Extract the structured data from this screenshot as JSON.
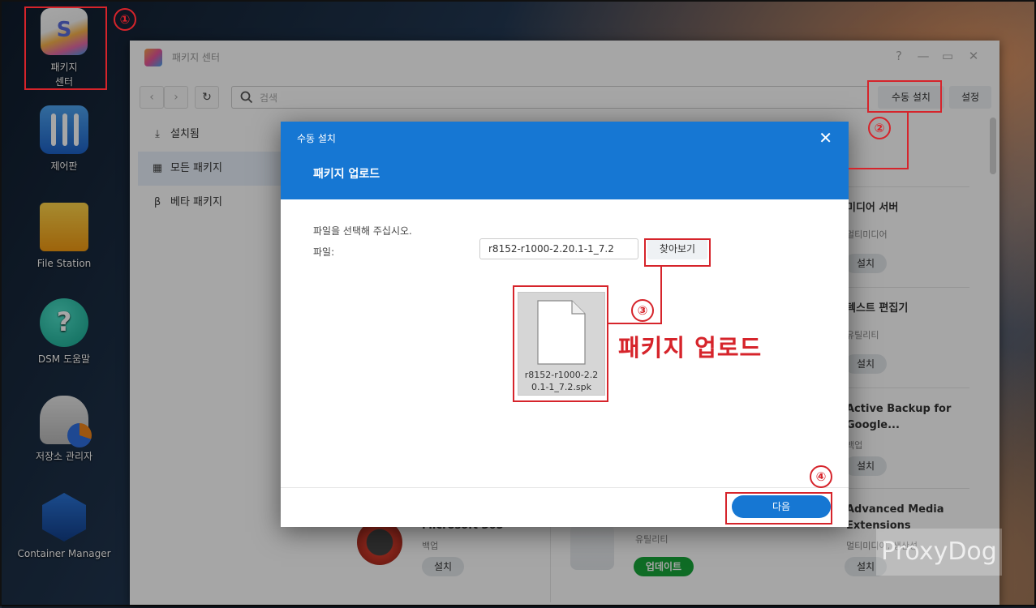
{
  "desktop": {
    "icons": [
      {
        "label_1": "패키지",
        "label_2": "센터"
      },
      {
        "label": "제어판"
      },
      {
        "label": "File Station"
      },
      {
        "label": "DSM 도움말"
      },
      {
        "label": "저장소 관리자"
      },
      {
        "label": "Container Manager"
      }
    ]
  },
  "window": {
    "title": "패키지 센터",
    "controls": {
      "help": "?",
      "minimize": "—",
      "maximize": "▭",
      "close": "✕"
    },
    "search_placeholder": "검색",
    "manual_install_label": "수동 설치",
    "settings_label": "설정",
    "sidebar": [
      {
        "label": "설치됨",
        "icon": "download-icon"
      },
      {
        "label": "모든 패키지",
        "icon": "grid-icon"
      },
      {
        "label": "베타 패키지",
        "icon": "beta-icon"
      }
    ],
    "cards_right": [
      {
        "name": "미디어 서버",
        "category": "멀티미디어",
        "action": "설치"
      },
      {
        "name": "텍스트 편집기",
        "category": "유틸리티",
        "action": "설치"
      },
      {
        "name": "Active Backup for Google...",
        "category": "백업",
        "action": "설치"
      },
      {
        "name": "Advanced Media Extensions",
        "category": "멀티미디어, 생산성",
        "action": "설치"
      }
    ],
    "cards_bottom": [
      {
        "name": "Microsoft 365",
        "category": "백업",
        "action": "설치"
      },
      {
        "category": "유틸리티",
        "action": "업데이트"
      }
    ]
  },
  "dialog": {
    "title": "수동 설치",
    "header": "패키지 업로드",
    "close": "✕",
    "instruction": "파일을 선택해 주십시오.",
    "file_label": "파일:",
    "file_value": "r8152-r1000-2.20.1-1_7.2",
    "browse_label": "찾아보기",
    "file_name_line1": "r8152-r1000-2.2",
    "file_name_line2": "0.1-1_7.2.spk",
    "next_label": "다음"
  },
  "annotations": {
    "step1": "①",
    "step2": "②",
    "step3": "③",
    "step4": "④",
    "upload_text": "패키지 업로드",
    "color": "#d6242b"
  },
  "watermark": "ProxyDog",
  "colors": {
    "accent": "#1677d3",
    "update_green": "#18a63a"
  }
}
